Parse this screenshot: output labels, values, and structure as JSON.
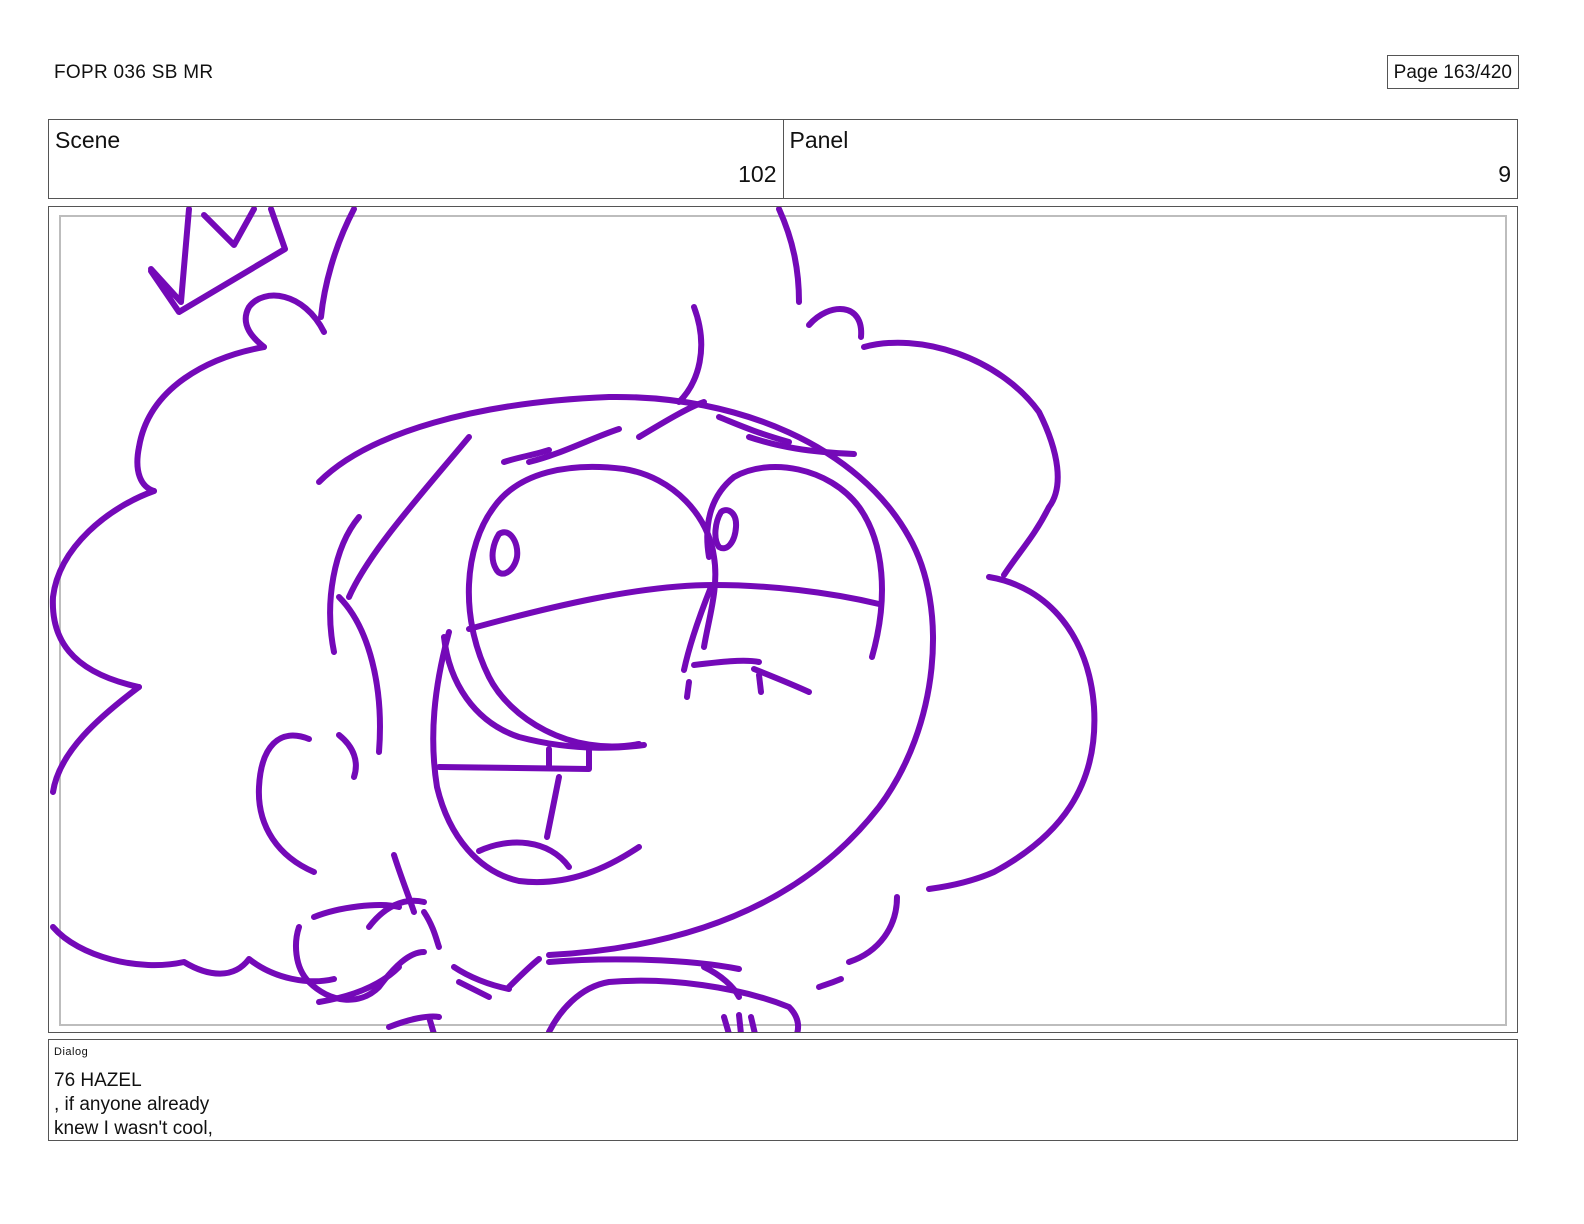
{
  "header": {
    "document_title": "FOPR 036 SB MR",
    "page_label": "Page 163/420"
  },
  "meta": {
    "scene_label": "Scene",
    "scene_value": "102",
    "panel_label": "Panel",
    "panel_value": "9"
  },
  "artwork": {
    "stroke_color": "#7409b8"
  },
  "dialog": {
    "label": "Dialog",
    "lines": [
      "76 HAZEL",
      ", if anyone already",
      "knew I wasn't cool,"
    ]
  }
}
